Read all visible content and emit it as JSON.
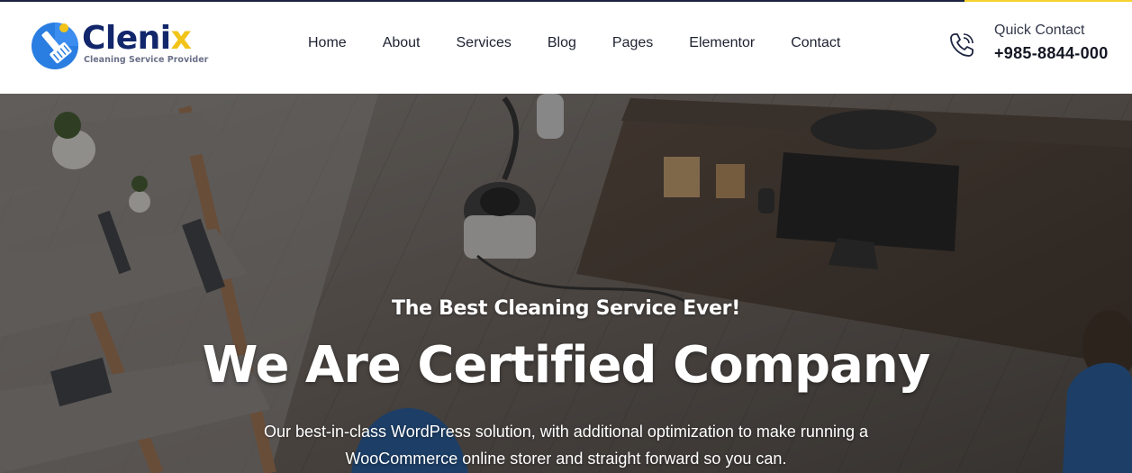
{
  "brand": {
    "name": "Clenix",
    "tagline": "Cleaning Service Provider",
    "primary_color": "#12266b",
    "accent_color": "#f2c41a",
    "logo_icon": "broom-icon"
  },
  "nav": {
    "items": [
      {
        "label": "Home"
      },
      {
        "label": "About"
      },
      {
        "label": "Services"
      },
      {
        "label": "Blog"
      },
      {
        "label": "Pages"
      },
      {
        "label": "Elementor"
      },
      {
        "label": "Contact"
      }
    ]
  },
  "contact": {
    "icon": "phone-icon",
    "label": "Quick Contact",
    "phone": "+985-8844-000"
  },
  "hero": {
    "kicker": "The Best Cleaning Service Ever!",
    "title": "We Are Certified Company",
    "description_line1": "Our best-in-class WordPress solution, with additional optimization to make running a",
    "description_line2": "WooCommerce online storer and straight forward so you can."
  }
}
